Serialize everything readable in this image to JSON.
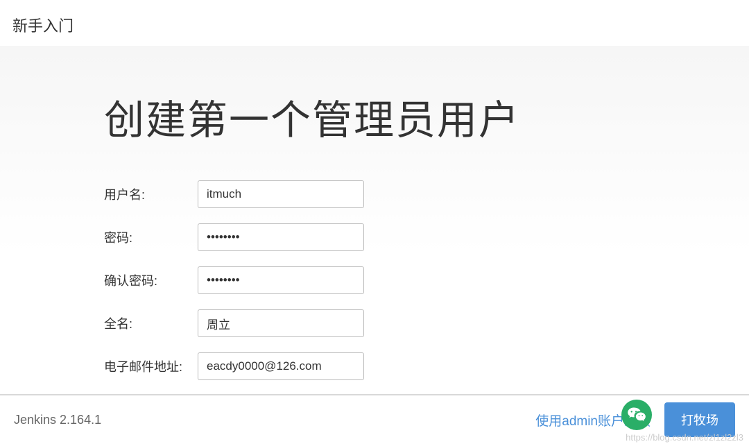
{
  "header": {
    "title": "新手入门"
  },
  "main": {
    "title": "创建第一个管理员用户",
    "form": {
      "username": {
        "label": "用户名:",
        "value": "itmuch"
      },
      "password": {
        "label": "密码:",
        "value": "••••••••"
      },
      "confirm_password": {
        "label": "确认密码:",
        "value": "••••••••"
      },
      "fullname": {
        "label": "全名:",
        "value": "周立"
      },
      "email": {
        "label": "电子邮件地址:",
        "value": "eacdy0000@126.com"
      }
    }
  },
  "footer": {
    "version": "Jenkins 2.164.1",
    "admin_continue": "使用admin账户继续",
    "save_button": "打牧场"
  },
  "watermark": "https://blog.csdn.net/zl1zl2zl3"
}
